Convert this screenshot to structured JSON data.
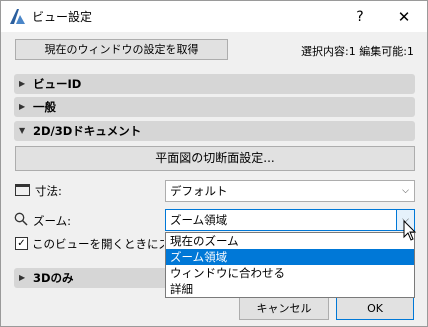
{
  "window": {
    "title": "ビュー設定",
    "help_label": "?",
    "close_label": "✕"
  },
  "toolbar": {
    "get_settings_label": "現在のウィンドウの設定を取得",
    "selection_info": "選択内容:1 編集可能:1"
  },
  "sections": {
    "view_id": "ビューID",
    "general": "一般",
    "doc_2d3d": "2D/3Dドキュメント",
    "only_3d": "3Dのみ"
  },
  "doc_2d3d": {
    "cut_plane_button": "平面図の切断面設定...",
    "dimension": {
      "label": "寸法:",
      "value": "デフォルト"
    },
    "zoom": {
      "label": "ズーム:",
      "value": "ズーム領域"
    },
    "checkbox": {
      "label": "このビューを開くときにズームと",
      "checked": true,
      "mark": "✓"
    }
  },
  "zoom_dropdown": {
    "options": [
      "現在のズーム",
      "ズーム領域",
      "ウィンドウに合わせる",
      "詳細"
    ],
    "selected_index": 1
  },
  "footer": {
    "cancel_label": "キャンセル",
    "ok_label": "OK"
  },
  "colors": {
    "accent": "#0078d7",
    "section_bg": "#d6d6d6",
    "dialog_bg": "#f0f0f0"
  }
}
